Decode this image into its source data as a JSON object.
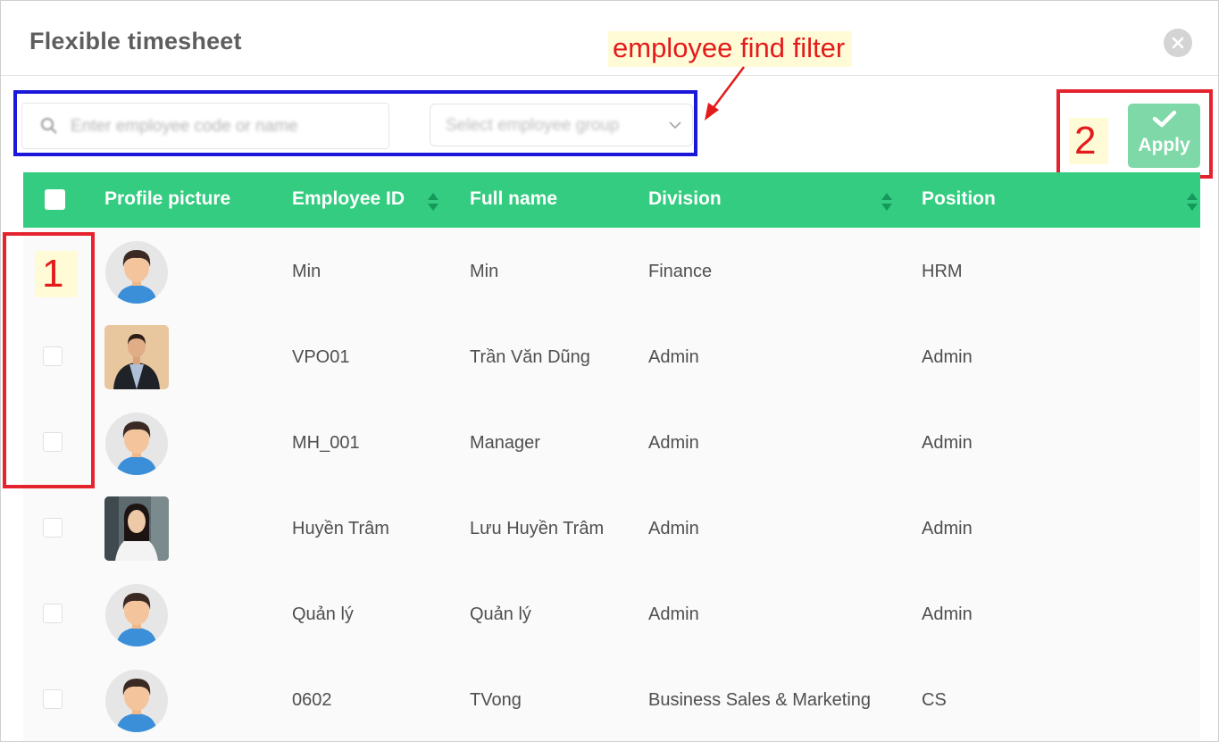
{
  "modal": {
    "title": "Flexible timesheet"
  },
  "filter": {
    "search_placeholder": "Enter employee code or name",
    "group_placeholder": "Select employee group"
  },
  "apply": {
    "label": "Apply"
  },
  "annotations": {
    "filter_note": "employee find filter",
    "marker_1": "1",
    "marker_2": "2"
  },
  "colors": {
    "header_green": "#33cc80",
    "apply_green": "#7ed8a8",
    "annotation_red": "#e5232e",
    "filter_box_blue": "#1a17d8"
  },
  "table": {
    "columns": [
      "Profile picture",
      "Employee ID",
      "Full name",
      "Division",
      "Position"
    ],
    "rows": [
      {
        "id": "Min",
        "name": "Min",
        "division": "Finance",
        "position": "HRM",
        "avatar": "default-avatar"
      },
      {
        "id": "VPO01",
        "name": "Trần Văn Dũng",
        "division": "Admin",
        "position": "Admin",
        "avatar": "photo-man-suit"
      },
      {
        "id": "MH_001",
        "name": "Manager",
        "division": "Admin",
        "position": "Admin",
        "avatar": "default-avatar"
      },
      {
        "id": "Huyền Trâm",
        "name": "Lưu Huyền Trâm",
        "division": "Admin",
        "position": "Admin",
        "avatar": "photo-woman"
      },
      {
        "id": "Quản lý",
        "name": "Quản lý",
        "division": "Admin",
        "position": "Admin",
        "avatar": "default-avatar"
      },
      {
        "id": "0602",
        "name": "TVong",
        "division": "Business Sales & Marketing",
        "position": "CS",
        "avatar": "default-avatar"
      }
    ]
  }
}
